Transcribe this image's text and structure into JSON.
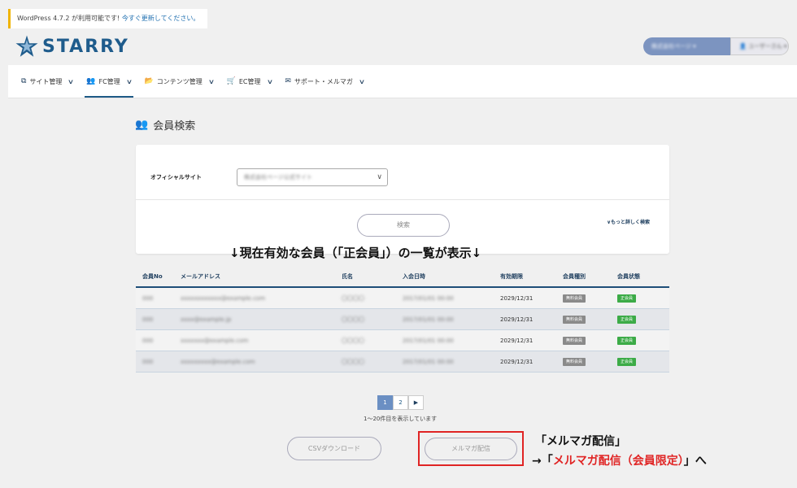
{
  "notice": {
    "prefix": "WordPress 4.7.2 が利用可能です! ",
    "link": "今すぐ更新してください。"
  },
  "brand": {
    "name": "STARRY",
    "color": "#1f5c8c"
  },
  "account": {
    "site_label": "株式会社ページ ▾",
    "user_label": "👤 ユーザーさん ▾"
  },
  "nav": [
    {
      "icon": "copy-icon",
      "glyph": "⧉",
      "label": "サイト管理",
      "active": false
    },
    {
      "icon": "users-icon",
      "glyph": "👥",
      "label": "FC管理",
      "active": true
    },
    {
      "icon": "folder-icon",
      "glyph": "📂",
      "label": "コンテンツ管理",
      "active": false
    },
    {
      "icon": "cart-icon",
      "glyph": "🛒",
      "label": "EC管理",
      "active": false
    },
    {
      "icon": "mail-icon",
      "glyph": "✉",
      "label": "サポート・メルマガ",
      "active": false
    }
  ],
  "page": {
    "title": "会員検索",
    "title_icon": "users-icon"
  },
  "search": {
    "field_label": "オフィシャルサイト",
    "select_value": "株式会社ページ公式サイト",
    "search_button": "検索",
    "more_link": "∨もっと詳しく検索"
  },
  "annotation_main": "↓現在有効な会員（「正会員」）の一覧が表示↓",
  "table": {
    "headers": [
      "会員No",
      "メールアドレス",
      "氏名",
      "入会日時",
      "有効期限",
      "会員種別",
      "会員状態"
    ],
    "rows": [
      {
        "no": "000",
        "email": "xxxxxxxxxxxx@example.com",
        "name": "〇〇〇〇",
        "joined": "2017/01/01 00:00",
        "expiry": "2029/12/31",
        "type": "無料会員",
        "status": "正会員"
      },
      {
        "no": "000",
        "email": "xxxx@example.jp",
        "name": "〇〇〇〇",
        "joined": "2017/01/01 00:00",
        "expiry": "2029/12/31",
        "type": "無料会員",
        "status": "正会員"
      },
      {
        "no": "000",
        "email": "xxxxxxx@example.com",
        "name": "〇〇〇〇",
        "joined": "2017/01/01 00:00",
        "expiry": "2029/12/31",
        "type": "無料会員",
        "status": "正会員"
      },
      {
        "no": "000",
        "email": "xxxxxxxxx@example.com",
        "name": "〇〇〇〇",
        "joined": "2017/01/01 00:00",
        "expiry": "2029/12/31",
        "type": "無料会員",
        "status": "正会員"
      }
    ]
  },
  "pagination": {
    "pages": [
      "1",
      "2"
    ],
    "next": "▶",
    "info": "1〜20件目を表示しています"
  },
  "actions": {
    "csv": "CSVダウンロード",
    "mail": "メルマガ配信"
  },
  "annotation_1": "「メルマガ配信」",
  "annotation_2": {
    "prefix": "→「",
    "highlight": "メルマガ配信（会員限定）",
    "suffix": "」へ"
  }
}
